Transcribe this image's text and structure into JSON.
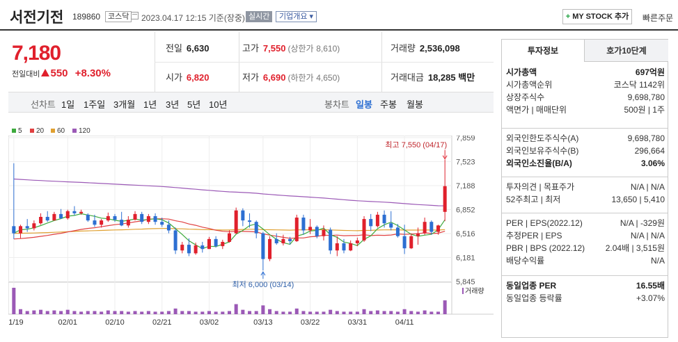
{
  "header": {
    "title": "서전기전",
    "code": "189860",
    "market": "코스닥",
    "datetime": "2023.04.17 12:15",
    "basis": "기준(장중)",
    "realtime": "실시간",
    "corp_info": "기업개요",
    "mystock_plus": "+",
    "mystock": "MY STOCK 추가",
    "quick_order": "빠른주문"
  },
  "price": {
    "current": "7,180",
    "change_label": "전일대비",
    "change": "550",
    "change_pct": "+8.30%"
  },
  "quote": {
    "prev_label": "전일",
    "prev": "6,630",
    "high_label": "고가",
    "high": "7,550",
    "upper_label": "(상한가",
    "upper": "8,610)",
    "volume_label": "거래량",
    "volume": "2,536,098",
    "open_label": "시가",
    "open": "6,820",
    "low_label": "저가",
    "low": "6,690",
    "lower_label": "(하한가",
    "lower": "4,650)",
    "amount_label": "거래대금",
    "amount": "18,285",
    "amount_unit": "백만"
  },
  "periodbar": {
    "line_label": "선차트",
    "line_periods": [
      "1일",
      "1주일",
      "3개월",
      "1년",
      "3년",
      "5년",
      "10년"
    ],
    "candle_label": "봉차트",
    "candle_periods": [
      "일봉",
      "주봉",
      "월봉"
    ],
    "candle_active": 0
  },
  "legend": [
    {
      "label": "5",
      "color": "#3daa3d"
    },
    {
      "label": "20",
      "color": "#e04040"
    },
    {
      "label": "60",
      "color": "#e0a030"
    },
    {
      "label": "120",
      "color": "#9b59b6"
    }
  ],
  "chart_data": {
    "type": "candlestick",
    "y_ticks": [
      "7,859",
      "7,523",
      "7,188",
      "6,852",
      "6,516",
      "6,181",
      "5,845"
    ],
    "ylim": [
      5845,
      7859
    ],
    "x_ticks": [
      "01/19",
      "02/01",
      "02/10",
      "02/21",
      "03/02",
      "03/13",
      "03/22",
      "03/31",
      "04/11"
    ],
    "x_tick_index": [
      0,
      8,
      15,
      22,
      29,
      37,
      44,
      51,
      58
    ],
    "high_annotation": "최고 7,550 (04/17)",
    "low_annotation": "최저 6,000 (03/14)",
    "volume_label": "거래량",
    "up_color": "#e0202c",
    "down_color": "#2d6fd2",
    "candles": [
      [
        6620,
        7500,
        6440,
        6520
      ],
      [
        6520,
        6640,
        6450,
        6620
      ],
      [
        6620,
        6720,
        6540,
        6590
      ],
      [
        6590,
        6700,
        6560,
        6660
      ],
      [
        6660,
        6800,
        6640,
        6750
      ],
      [
        6750,
        6830,
        6680,
        6700
      ],
      [
        6700,
        6820,
        6700,
        6790
      ],
      [
        6790,
        6860,
        6720,
        6730
      ],
      [
        6730,
        6850,
        6710,
        6830
      ],
      [
        6830,
        6900,
        6770,
        6800
      ],
      [
        6800,
        6850,
        6780,
        6820
      ],
      [
        6780,
        6800,
        6680,
        6700
      ],
      [
        6700,
        6780,
        6610,
        6640
      ],
      [
        6640,
        6720,
        6600,
        6700
      ],
      [
        6700,
        6810,
        6680,
        6760
      ],
      [
        6760,
        6790,
        6680,
        6710
      ],
      [
        6710,
        6820,
        6620,
        6630
      ],
      [
        6630,
        6760,
        6600,
        6710
      ],
      [
        6710,
        6830,
        6700,
        6790
      ],
      [
        6790,
        6820,
        6650,
        6680
      ],
      [
        6680,
        6790,
        6650,
        6760
      ],
      [
        6760,
        6800,
        6640,
        6680
      ],
      [
        6680,
        6740,
        6610,
        6640
      ],
      [
        6640,
        6700,
        6520,
        6560
      ],
      [
        6560,
        6600,
        6230,
        6280
      ],
      [
        6280,
        6400,
        6240,
        6360
      ],
      [
        6360,
        6450,
        6200,
        6240
      ],
      [
        6240,
        6390,
        6220,
        6350
      ],
      [
        6350,
        6400,
        6250,
        6300
      ],
      [
        6300,
        6470,
        6300,
        6440
      ],
      [
        6440,
        6480,
        6320,
        6340
      ],
      [
        6340,
        6430,
        6300,
        6400
      ],
      [
        6400,
        6560,
        6390,
        6520
      ],
      [
        6520,
        6880,
        6510,
        6840
      ],
      [
        6840,
        6870,
        6620,
        6700
      ],
      [
        6700,
        6800,
        6600,
        6680
      ],
      [
        6680,
        6700,
        6450,
        6520
      ],
      [
        6520,
        6540,
        6000,
        6160
      ],
      [
        6160,
        6480,
        6130,
        6440
      ],
      [
        6440,
        6520,
        6360,
        6380
      ],
      [
        6380,
        6500,
        6350,
        6440
      ],
      [
        6440,
        6470,
        6360,
        6410
      ],
      [
        6410,
        6780,
        6400,
        6740
      ],
      [
        6740,
        6780,
        6500,
        6560
      ],
      [
        6560,
        6720,
        6510,
        6610
      ],
      [
        6610,
        6630,
        6450,
        6480
      ],
      [
        6480,
        6630,
        6420,
        6570
      ],
      [
        6570,
        6600,
        6230,
        6280
      ],
      [
        6280,
        6480,
        6200,
        6380
      ],
      [
        6380,
        6440,
        6240,
        6280
      ],
      [
        6280,
        6420,
        6270,
        6380
      ],
      [
        6380,
        6460,
        6340,
        6420
      ],
      [
        6420,
        6760,
        6400,
        6720
      ],
      [
        6720,
        6790,
        6550,
        6620
      ],
      [
        6620,
        6820,
        6600,
        6780
      ],
      [
        6780,
        6840,
        6600,
        6660
      ],
      [
        6660,
        6830,
        6560,
        6600
      ],
      [
        6600,
        6650,
        6460,
        6480
      ],
      [
        6480,
        6640,
        6230,
        6310
      ],
      [
        6310,
        6520,
        6300,
        6480
      ],
      [
        6480,
        6600,
        6360,
        6520
      ],
      [
        6520,
        6740,
        6500,
        6680
      ],
      [
        6680,
        6700,
        6500,
        6540
      ],
      [
        6540,
        6640,
        6500,
        6630
      ],
      [
        6820,
        7550,
        6690,
        7180
      ]
    ],
    "volumes": [
      0.42,
      0.08,
      0.05,
      0.06,
      0.07,
      0.05,
      0.06,
      0.05,
      0.07,
      0.05,
      0.04,
      0.05,
      0.05,
      0.04,
      0.06,
      0.05,
      0.05,
      0.04,
      0.05,
      0.04,
      0.05,
      0.04,
      0.04,
      0.05,
      0.09,
      0.05,
      0.05,
      0.04,
      0.04,
      0.05,
      0.04,
      0.04,
      0.05,
      0.16,
      0.07,
      0.05,
      0.05,
      0.14,
      0.08,
      0.05,
      0.04,
      0.04,
      0.09,
      0.05,
      0.04,
      0.04,
      0.04,
      0.07,
      0.05,
      0.04,
      0.04,
      0.04,
      0.08,
      0.05,
      0.06,
      0.05,
      0.05,
      0.04,
      0.08,
      0.05,
      0.04,
      0.06,
      0.04,
      0.04,
      0.22
    ]
  },
  "info": {
    "tab_active": "투자정보",
    "tab_other": "호가10단계",
    "rows1": [
      {
        "l": "시가총액",
        "r": "697억원",
        "bold": true
      },
      {
        "l": "시가총액순위",
        "r": "코스닥 1142위"
      },
      {
        "l": "상장주식수",
        "r": "9,698,780"
      },
      {
        "l": "액면가 | 매매단위",
        "r": "500원 | 1주"
      }
    ],
    "rows2": [
      {
        "l": "외국인한도주식수(A)",
        "r": "9,698,780"
      },
      {
        "l": "외국인보유주식수(B)",
        "r": "296,664"
      },
      {
        "l": "외국인소진율(B/A)",
        "r": "3.06%",
        "bold": true
      }
    ],
    "rows3": [
      {
        "l": "투자의견 | 목표주가",
        "r": "N/A | N/A"
      },
      {
        "l": "52주최고 | 최저",
        "r": "13,650 | 5,410"
      }
    ],
    "rows4": [
      {
        "l": "PER | EPS(2022.12)",
        "r": "N/A | -329원"
      },
      {
        "l": "추정PER | EPS",
        "r": "N/A | N/A"
      },
      {
        "l": "PBR | BPS (2022.12)",
        "r": "2.04배 | 3,515원"
      },
      {
        "l": "배당수익률",
        "r": "N/A"
      }
    ],
    "rows5": [
      {
        "l": "동일업종 PER",
        "r": "16.55배",
        "bold": true
      },
      {
        "l": "동일업종 등락률",
        "r": "+3.07%",
        "red": true
      }
    ]
  }
}
